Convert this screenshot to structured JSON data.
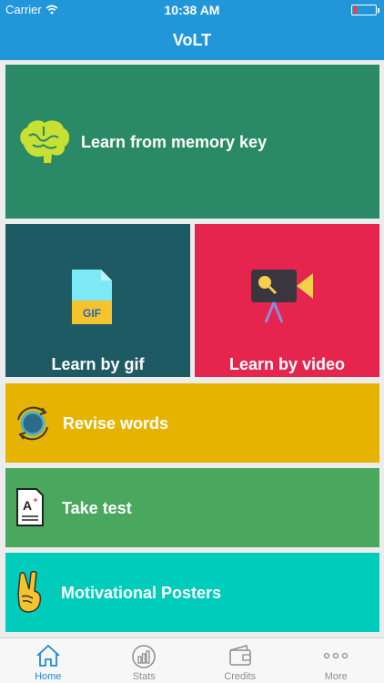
{
  "status_bar": {
    "carrier": "Carrier",
    "time": "10:38 AM"
  },
  "nav": {
    "title": "VoLT"
  },
  "tiles": {
    "memory": "Learn from memory key",
    "gif": "Learn by gif",
    "gif_badge": "GIF",
    "video": "Learn by video",
    "revise": "Revise words",
    "test": "Take test",
    "posters": "Motivational Posters"
  },
  "tabs": [
    {
      "label": "Home",
      "icon": "home-icon",
      "active": true
    },
    {
      "label": "Stats",
      "icon": "stats-icon",
      "active": false
    },
    {
      "label": "Credits",
      "icon": "wallet-icon",
      "active": false
    },
    {
      "label": "More",
      "icon": "more-icon",
      "active": false
    }
  ],
  "colors": {
    "nav": "#2196d9",
    "memory": "#2a8a67",
    "gif": "#1e5a63",
    "video": "#e6254e",
    "revise": "#e6b300",
    "test": "#4aa85e",
    "posters": "#00ccbb",
    "active_tab": "#1e88d9"
  }
}
